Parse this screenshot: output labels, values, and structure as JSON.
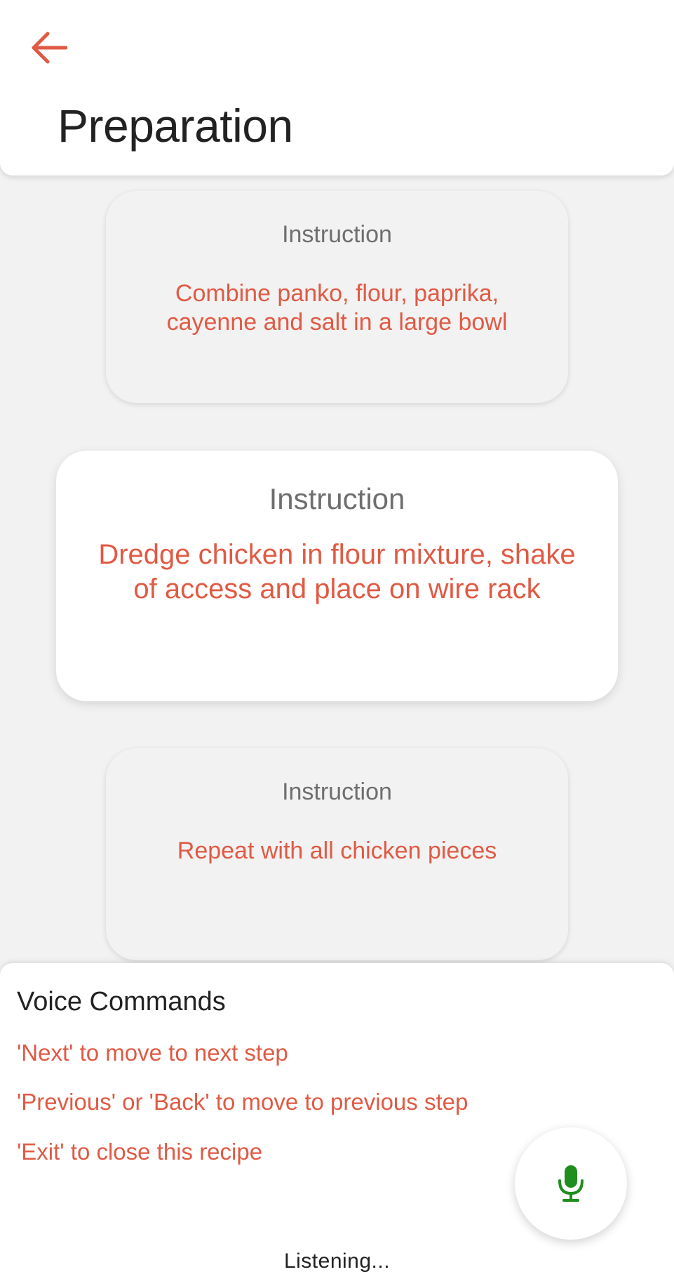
{
  "header": {
    "back_icon": "arrow-left-icon",
    "title": "Preparation"
  },
  "instructions": [
    {
      "label": "Instruction",
      "text": "Combine panko, flour, paprika, cayenne and salt in a large bowl"
    },
    {
      "label": "Instruction",
      "text": "Dredge chicken in flour mixture, shake of access and place on wire rack"
    },
    {
      "label": "Instruction",
      "text": "Repeat with all chicken  pieces"
    }
  ],
  "voice": {
    "title": "Voice Commands",
    "commands": [
      "'Next' to move to next step",
      "'Previous' or 'Back' to move to previous step",
      "'Exit' to close this recipe"
    ],
    "mic_icon": "microphone-icon",
    "status": "Listening..."
  },
  "colors": {
    "accent": "#e05a44",
    "mic": "#1e8e1e",
    "background": "#f2f2f2",
    "label": "#6e6e6e"
  }
}
